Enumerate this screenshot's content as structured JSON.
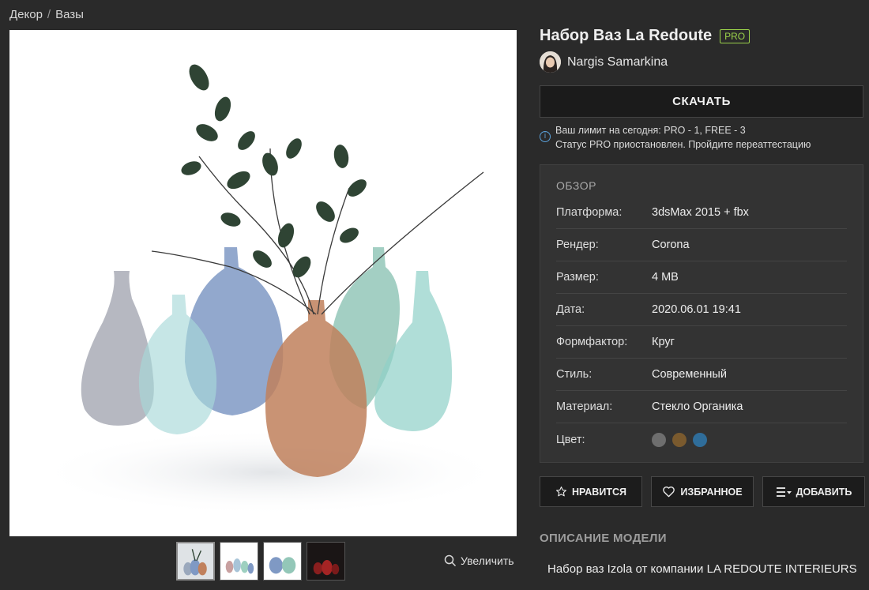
{
  "breadcrumb": {
    "items": [
      "Декор",
      "Вазы"
    ],
    "separator": "/"
  },
  "model": {
    "title": "Набор Ваз La Redoute",
    "badge": "PRO",
    "author": "Nargis Samarkina"
  },
  "download": {
    "label": "СКАЧАТЬ",
    "limit_line": "Ваш лимит на сегодня: PRO - 1, FREE - 3",
    "status_line": "Статус PRO приостановлен. Пройдите переаттестацию"
  },
  "overview": {
    "heading": "ОБЗОР",
    "rows": [
      {
        "label": "Платформа:",
        "value": "3dsMax 2015 + fbx"
      },
      {
        "label": "Рендер:",
        "value": "Corona"
      },
      {
        "label": "Размер:",
        "value": "4 MB"
      },
      {
        "label": "Дата:",
        "value": "2020.06.01 19:41"
      },
      {
        "label": "Формфактор:",
        "value": "Круг"
      },
      {
        "label": "Стиль:",
        "value": "Современный"
      },
      {
        "label": "Материал:",
        "value": "Стекло Органика"
      }
    ],
    "color_label": "Цвет:",
    "colors": [
      "#6e6e6e",
      "#7a5a2e",
      "#2f6d9a"
    ]
  },
  "actions": {
    "like": "НРАВИТСЯ",
    "favorite": "ИЗБРАННОЕ",
    "add": "ДОБАВИТЬ"
  },
  "gallery": {
    "zoom_label": "Увеличить"
  },
  "description": {
    "heading": "ОПИСАНИЕ МОДЕЛИ",
    "text": "Набор ваз Izola от компании LA REDOUTE INTERIEURS"
  }
}
